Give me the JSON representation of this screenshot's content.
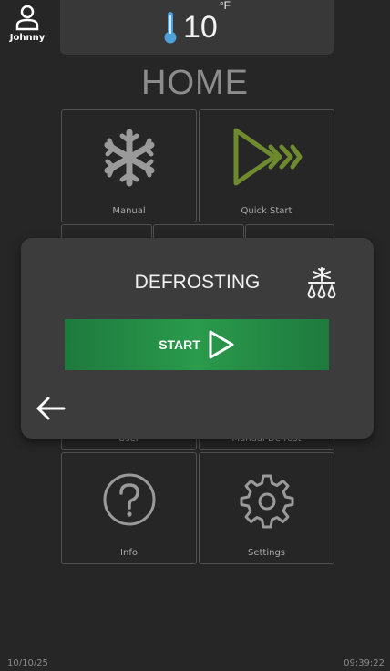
{
  "user": {
    "name": "Johnny"
  },
  "temperature": {
    "value": "10",
    "unit": "°F"
  },
  "page": {
    "title": "HOME"
  },
  "tiles": {
    "manual": "Manual",
    "quick_start": "Quick Start",
    "user": "User",
    "manual_defrost": "Manual Defrost",
    "info": "Info",
    "settings": "Settings"
  },
  "dialog": {
    "title": "DEFROSTING",
    "start_label": "START"
  },
  "footer": {
    "date": "10/10/25",
    "time": "09:39:22"
  },
  "colors": {
    "background": "#262626",
    "accent_green": "#2a9a4c",
    "play_green": "#6e8a2e",
    "thermometer": "#4f9fd8"
  }
}
